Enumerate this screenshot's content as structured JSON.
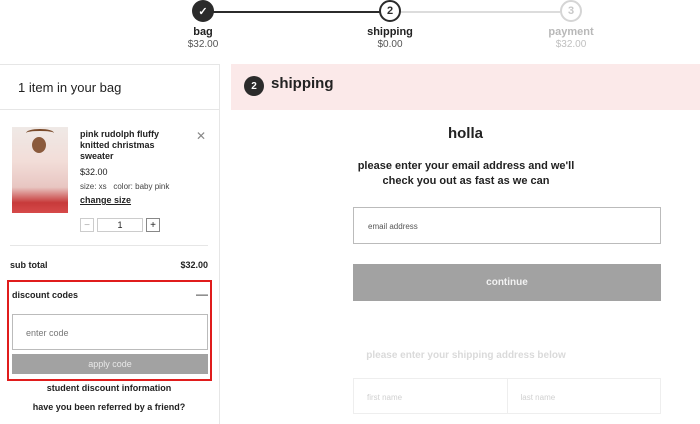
{
  "progress": {
    "steps": [
      {
        "name": "bag",
        "price": "$32.00",
        "number": "✓"
      },
      {
        "name": "shipping",
        "price": "$0.00",
        "number": "2"
      },
      {
        "name": "payment",
        "price": "$32.00",
        "number": "3"
      }
    ]
  },
  "bag": {
    "title": "1 item in your bag",
    "item": {
      "name": "pink rudolph fluffy knitted christmas sweater",
      "price": "$32.00",
      "size_label": "size: xs",
      "color_label": "color: baby pink",
      "change_size": "change size",
      "qty_minus": "−",
      "qty_value": "1",
      "qty_plus": "+",
      "remove": "✕"
    },
    "subtotal_label": "sub total",
    "subtotal_value": "$32.00",
    "discount": {
      "title": "discount codes",
      "toggle": "—",
      "placeholder": "enter code",
      "apply": "apply code"
    },
    "student_link": "student discount information",
    "referred_link": "have you been referred by a friend?"
  },
  "shipping": {
    "number": "2",
    "title": "shipping",
    "greeting": "holla",
    "prompt": "please enter your email address and we'll check you out as fast as we can",
    "email_placeholder": "email address",
    "continue": "continue",
    "address_prompt": "please enter your shipping address below",
    "first_name": "first name",
    "last_name": "last name"
  }
}
